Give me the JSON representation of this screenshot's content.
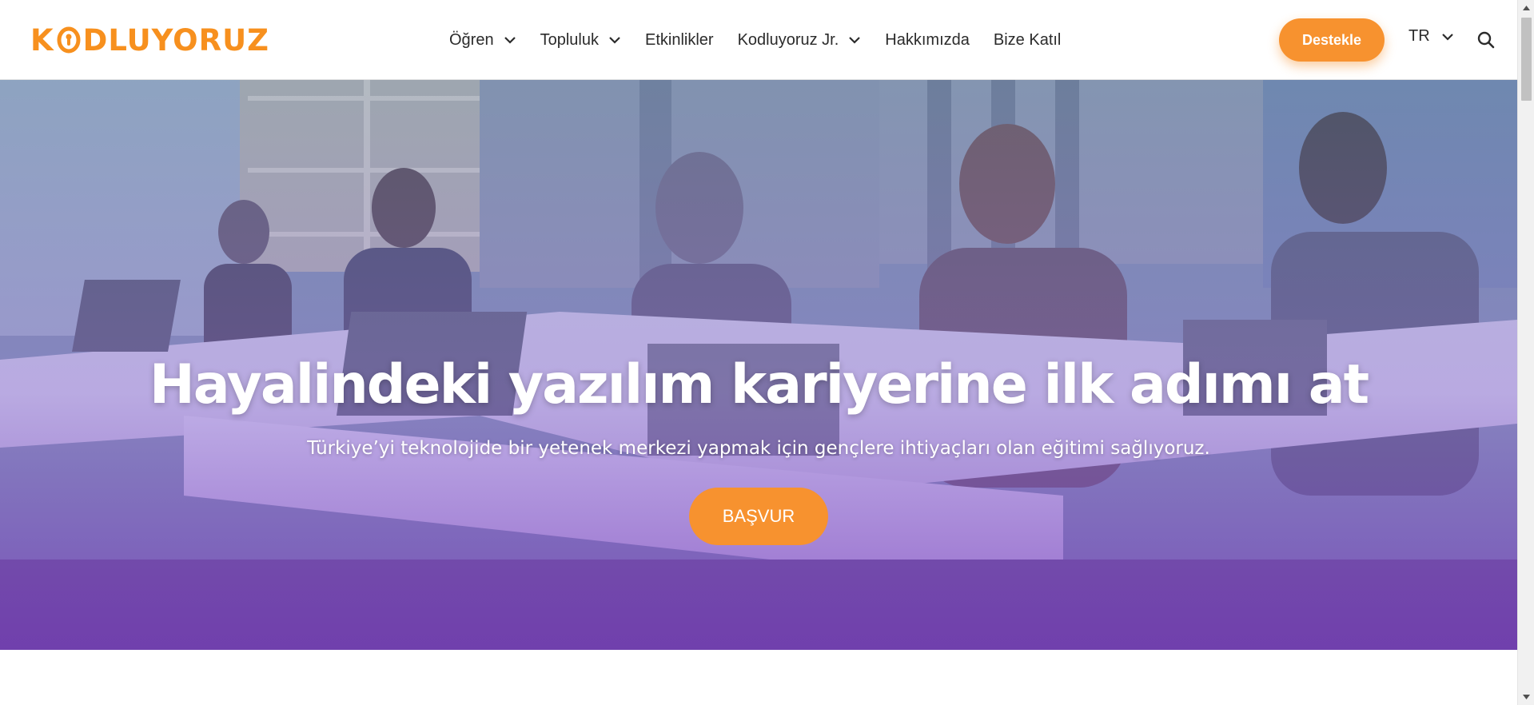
{
  "header": {
    "logo_text_left": "K",
    "logo_text_right": "DLUYORUZ",
    "nav": [
      {
        "label": "Öğren",
        "has_dropdown": true
      },
      {
        "label": "Topluluk",
        "has_dropdown": true
      },
      {
        "label": "Etkinlikler",
        "has_dropdown": false
      },
      {
        "label": "Kodluyoruz Jr.",
        "has_dropdown": true
      },
      {
        "label": "Hakkımızda",
        "has_dropdown": false
      },
      {
        "label": "Bize Katıl",
        "has_dropdown": false
      }
    ],
    "support_button": "Destekle",
    "language": "TR",
    "search_icon": "search-icon"
  },
  "hero": {
    "title": "Hayalindeki yazılım kariyerine ilk adımı at",
    "subtitle": "Türkiye’yi teknolojide bir yetenek merkezi yapmak için gençlere ihtiyaçları olan eğitimi sağlıyoruz.",
    "apply_button": "BAŞVUR"
  },
  "colors": {
    "brand_orange": "#f7922f",
    "logo_orange": "#f7901e",
    "text_dark": "#2b2b2b",
    "overlay_purple": "#7a3cbe"
  }
}
